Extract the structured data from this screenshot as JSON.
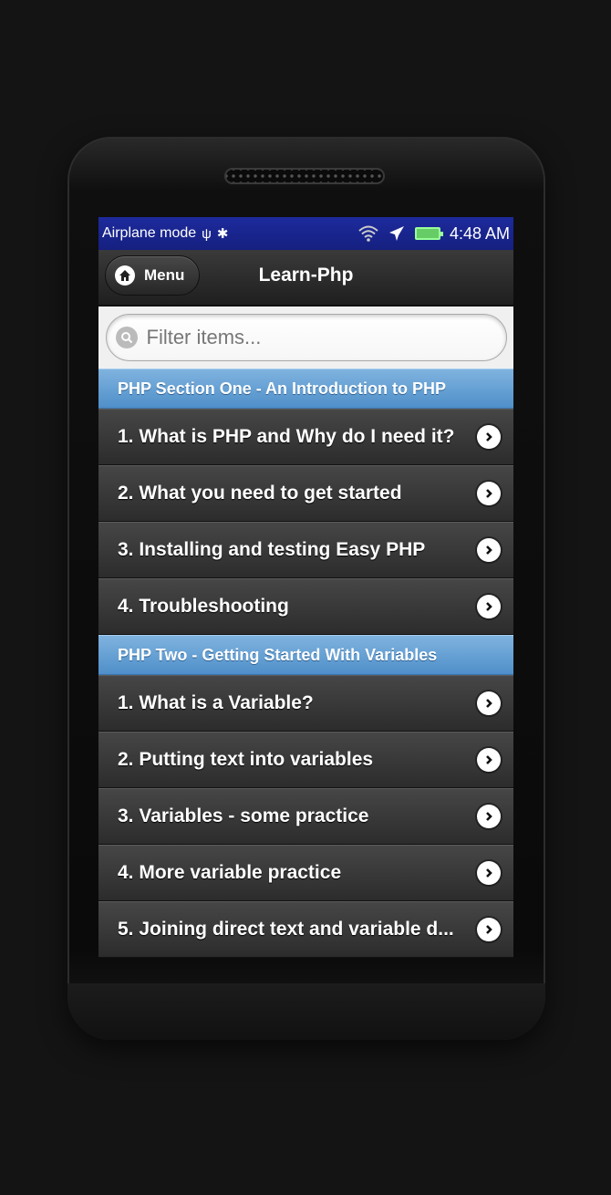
{
  "status_bar": {
    "mode_label": "Airplane mode",
    "usb_icon": "usb-icon",
    "android_icon": "android-debug-icon",
    "wifi_icon": "wifi-icon",
    "airplane_icon": "airplane-icon",
    "battery_icon": "battery-charging-icon",
    "time": "4:48 AM"
  },
  "header": {
    "menu_label": "Menu",
    "menu_icon": "home-icon",
    "title": "Learn-Php"
  },
  "filter": {
    "placeholder": "Filter items...",
    "value": ""
  },
  "sections": [
    {
      "title": "PHP Section One - An Introduction to PHP",
      "items": [
        "1. What is PHP and Why do I need it?",
        "2. What you need to get started",
        "3. Installing and testing Easy PHP",
        "4. Troubleshooting"
      ]
    },
    {
      "title": "PHP Two - Getting Started With Variables",
      "items": [
        "1. What is a Variable?",
        "2. Putting text into variables",
        "3. Variables - some practice",
        "4. More variable practice",
        "5. Joining direct text and variable d..."
      ]
    }
  ],
  "colors": {
    "divider": "#4f8fc9",
    "statusbar": "#1d2a9c",
    "item_bg": "#3a3a3a"
  }
}
